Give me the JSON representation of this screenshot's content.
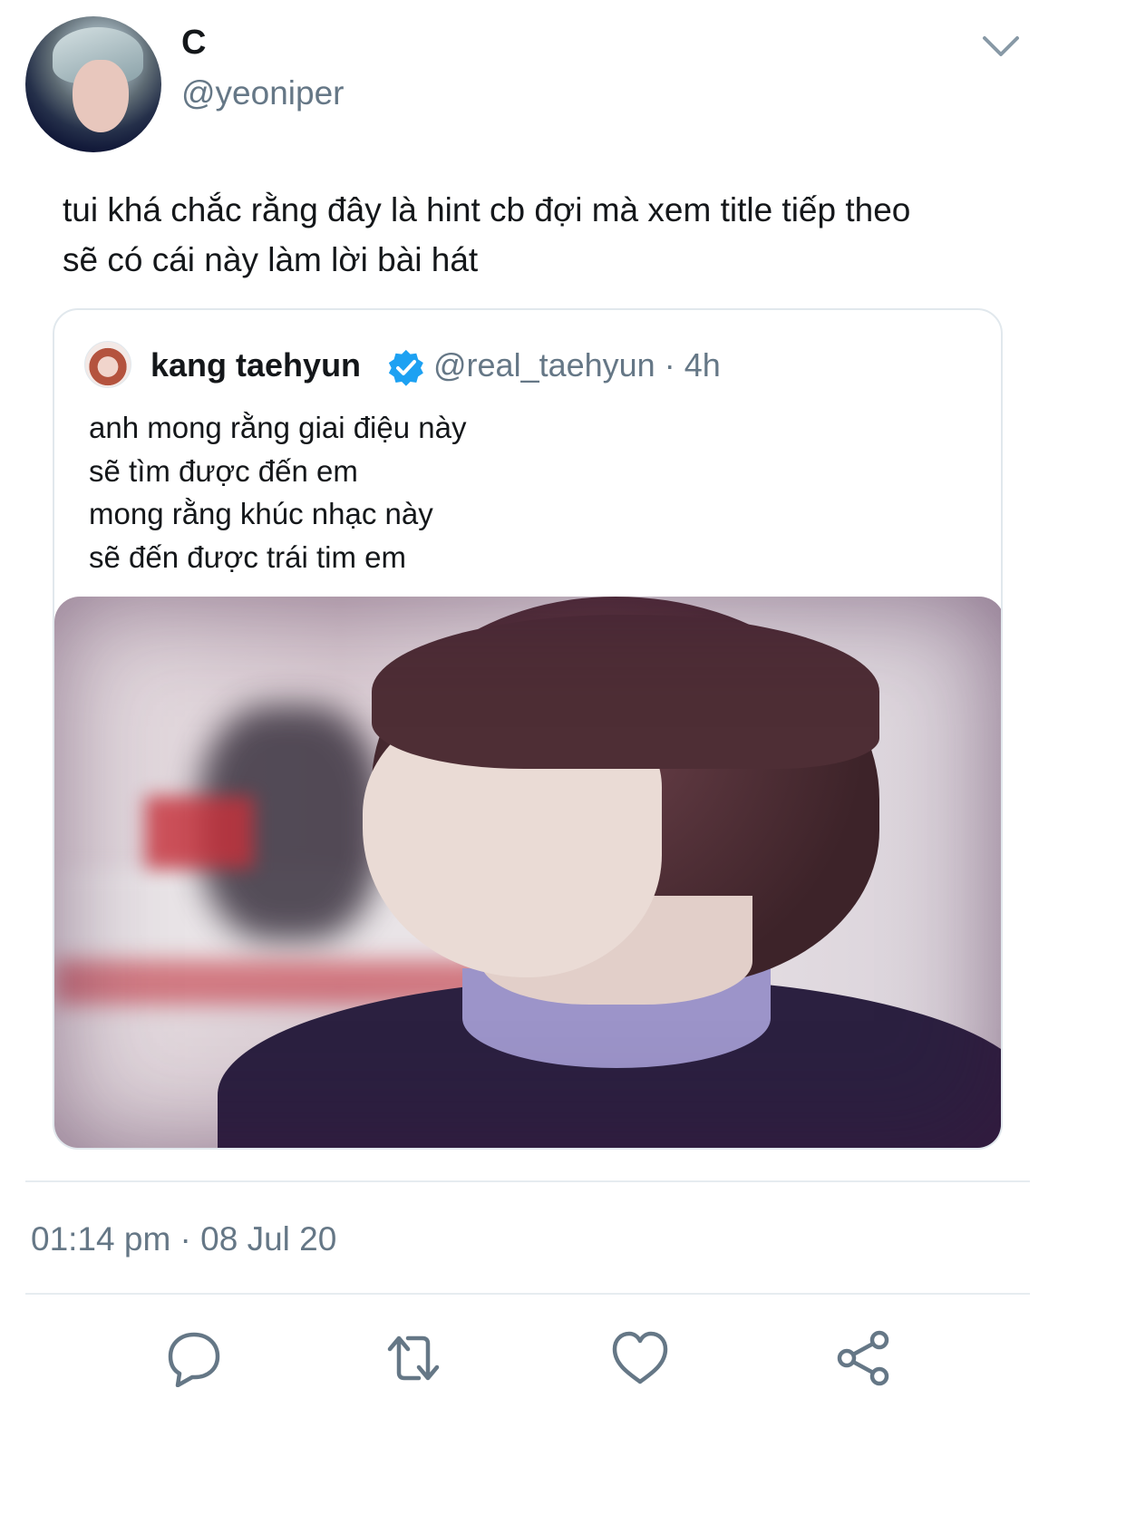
{
  "tweet": {
    "display_name": "C",
    "handle": "@yeoniper",
    "text_lines": [
      "tui khá chắc rằng đây là hint cb đợi mà xem title tiếp theo",
      "sẽ có cái này làm lời bài hát"
    ],
    "timestamp": "01:14 pm · 08 Jul 20"
  },
  "quoted": {
    "display_name": "kang taehyun",
    "handle_time": "@real_taehyun · 4h",
    "text_lines": [
      "anh mong rằng giai điệu này",
      "sẽ tìm được đến em",
      "mong rằng khúc nhạc này",
      "sẽ đến được trái tim em"
    ]
  },
  "colors": {
    "text": "#14171a",
    "secondary": "#657786",
    "border": "#e1e8ed",
    "verified": "#1da1f2",
    "icons": "#657786"
  },
  "icons": [
    "chevron-down-icon",
    "verified-icon",
    "reply-icon",
    "retweet-icon",
    "like-icon",
    "share-icon"
  ]
}
